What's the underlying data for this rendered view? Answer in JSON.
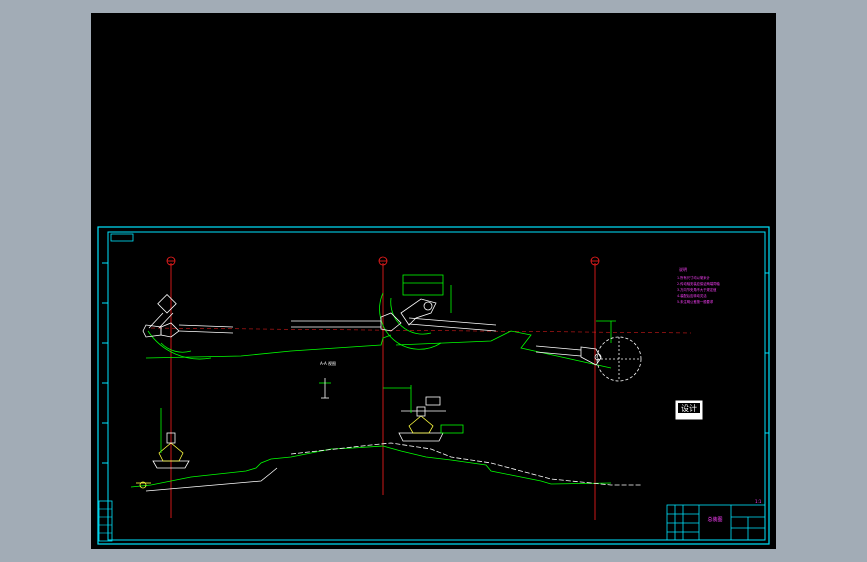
{
  "colors": {
    "background": "#a2acb6",
    "canvas": "#000000",
    "frame": "#00e5ff",
    "geometry": "#00ff00",
    "centerline": "#ff2020",
    "notes": "#ff40ff",
    "dimension": "#ffffff",
    "parts": "#ffffff",
    "highlight": "#ffff40"
  },
  "drawing": {
    "stamp_text": "设计",
    "notes_title": "说明",
    "notes_lines": [
      "1.所有尺寸均以毫米计",
      "2.传动轴安装应保证两端同轴",
      "3.万向节夹角不大于规定值",
      "4.装配后应转动灵活",
      "5.未注明公差按一般要求"
    ],
    "sheet_label": "总装图",
    "page_label": "1:1",
    "view_label": "A-A 视图"
  }
}
